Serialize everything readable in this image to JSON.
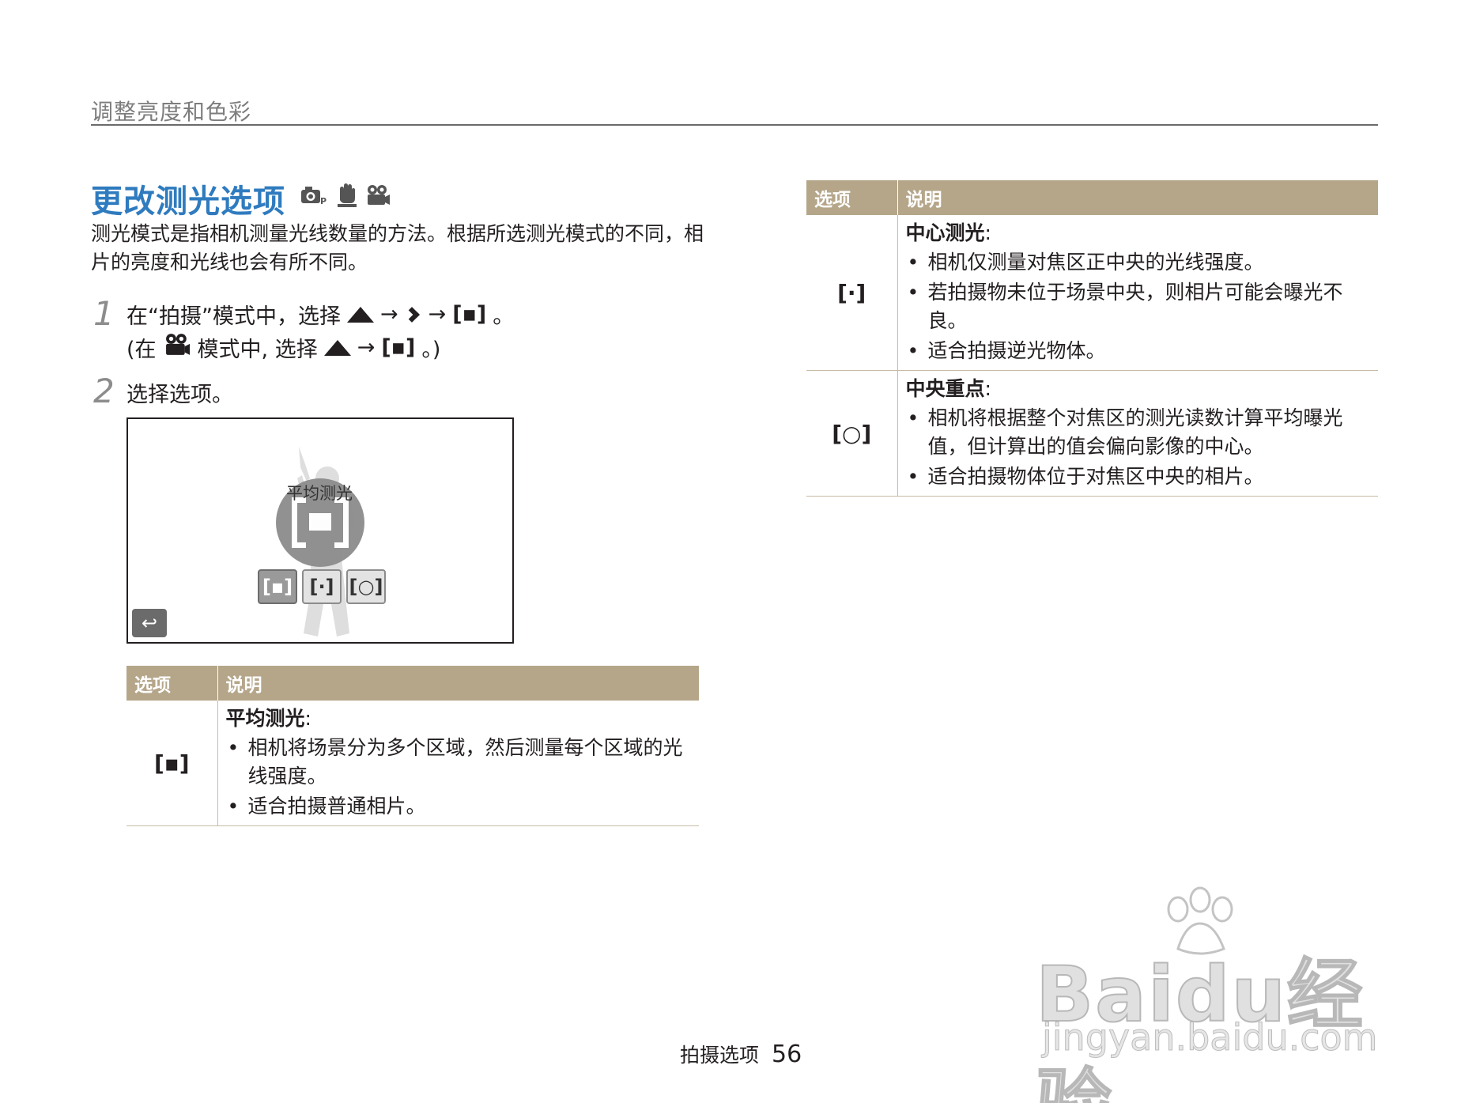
{
  "header": {
    "title": "调整亮度和色彩"
  },
  "section": {
    "title": "更改测光选项",
    "mode_icons": [
      "camera-program-icon",
      "dual-is-hand-icon",
      "movie-camera-icon"
    ],
    "intro": "测光模式是指相机测量光线数量的方法。根据所选测光模式的不同，相片的亮度和光线也会有所不同。"
  },
  "steps": [
    {
      "number": "1",
      "line1": {
        "prefix": "在“拍摄”模式中，选择",
        "arrow1": "→",
        "arrow2": "→",
        "glyph": "[▪]",
        "suffix": "。"
      },
      "line2": {
        "prefix": "(在",
        "middle": "模式中, 选择",
        "arrow": "→",
        "glyph": "[▪]",
        "suffix": "。)"
      }
    },
    {
      "number": "2",
      "text": "选择选项。"
    }
  ],
  "screen": {
    "label": "平均测光",
    "options": [
      "[▪]",
      "[·]",
      "[○]"
    ],
    "back_glyph": "↩"
  },
  "table_left": {
    "headers": [
      "选项",
      "说明"
    ],
    "rows": [
      {
        "symbol": "[▪]",
        "name": "平均测光",
        "colon": ":",
        "bullets": [
          "相机将场景分为多个区域，然后测量每个区域的光线强度。",
          "适合拍摄普通相片。"
        ]
      }
    ]
  },
  "table_right": {
    "headers": [
      "选项",
      "说明"
    ],
    "rows": [
      {
        "symbol": "[·]",
        "name": "中心测光",
        "colon": ":",
        "bullets": [
          "相机仅测量对焦区正中央的光线强度。",
          "若拍摄物未位于场景中央，则相片可能会曝光不良。",
          "适合拍摄逆光物体。"
        ]
      },
      {
        "symbol": "[○]",
        "name": "中央重点",
        "colon": ":",
        "bullets": [
          "相机将根据整个对焦区的测光读数计算平均曝光值，但计算出的值会偏向影像的中心。",
          "适合拍摄物体位于对焦区中央的相片。"
        ]
      }
    ]
  },
  "footer": {
    "section": "拍摄选项",
    "page": "56"
  },
  "watermark": {
    "main": "Baidu经验",
    "sub": "jingyan.baidu.com"
  }
}
